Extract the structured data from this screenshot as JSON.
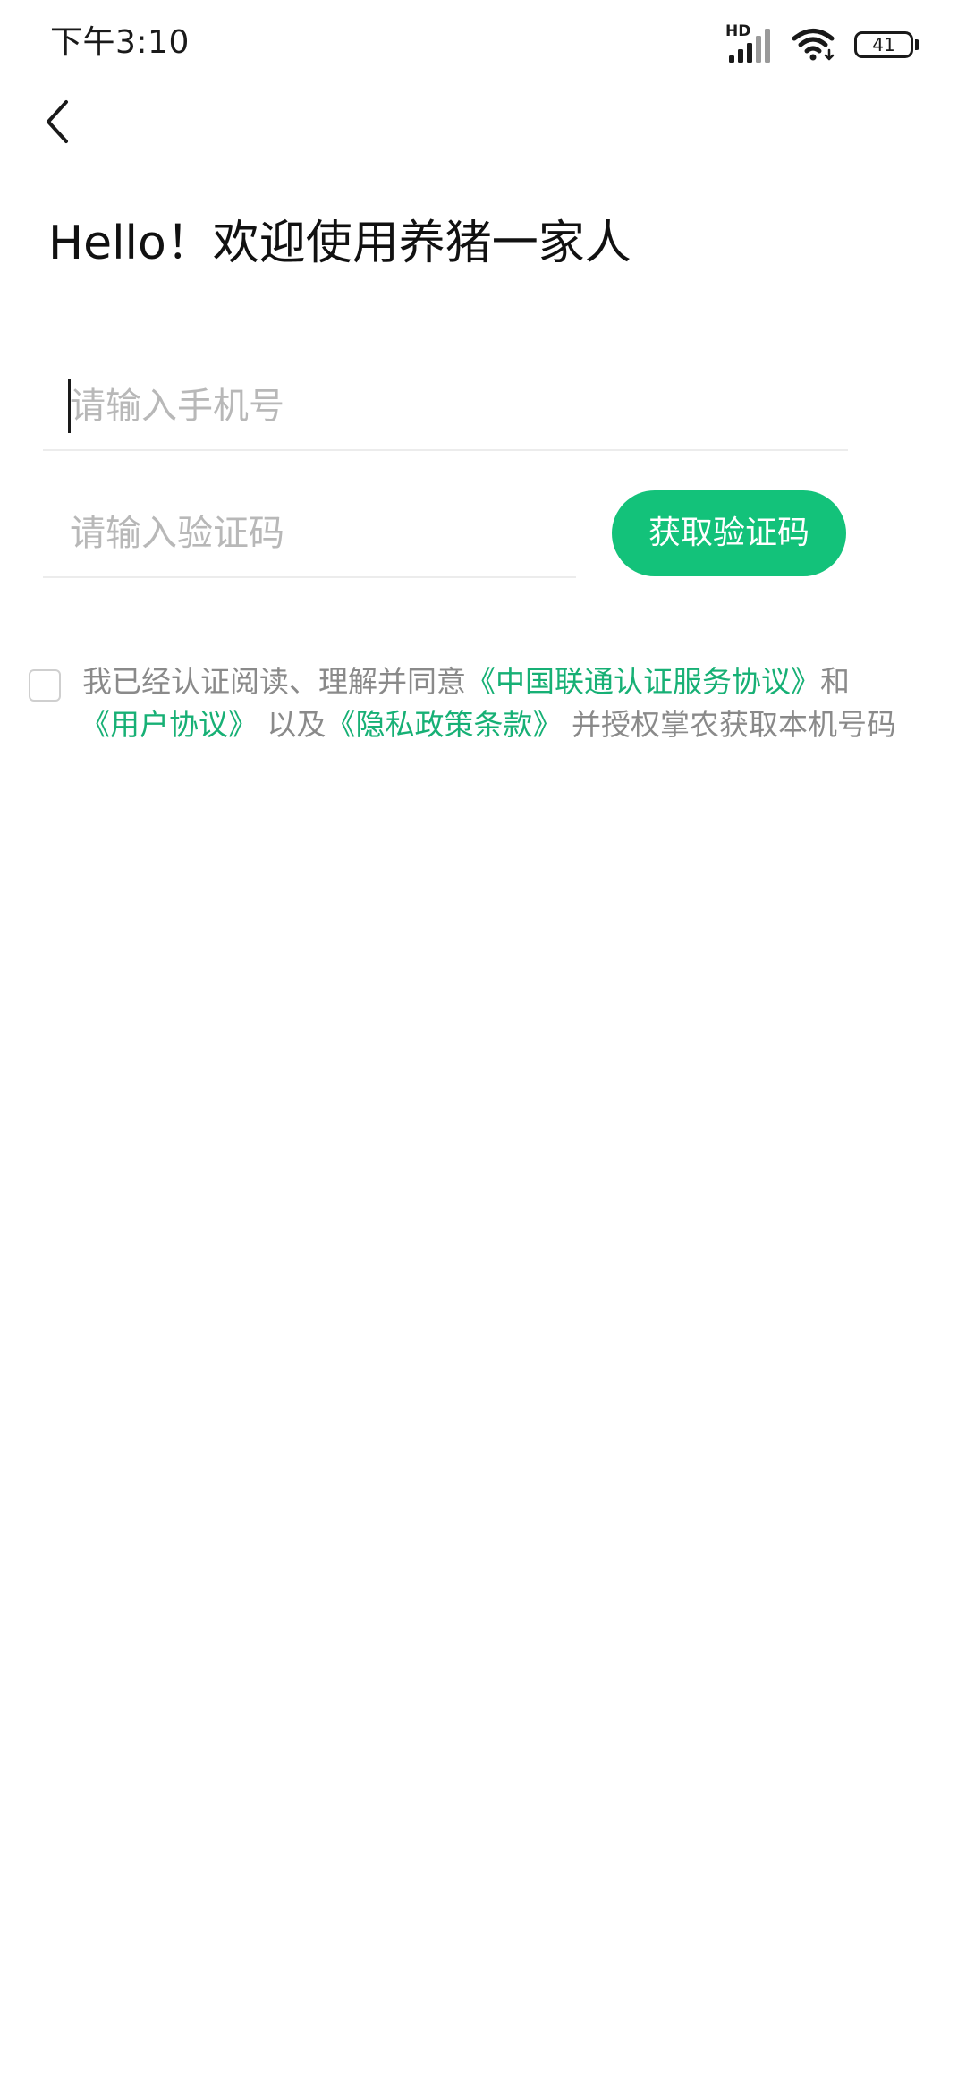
{
  "status_bar": {
    "time": "下午3:10",
    "network_badge": "HD",
    "battery_level": "41",
    "icons": [
      "signal-icon",
      "wifi-icon",
      "battery-icon"
    ]
  },
  "header": {
    "back_icon": "chevron-left-icon",
    "title": "Hello！欢迎使用养猪一家人"
  },
  "form": {
    "phone_placeholder": "请输入手机号",
    "phone_value": "",
    "code_placeholder": "请输入验证码",
    "code_value": "",
    "get_code_label": "获取验证码"
  },
  "agreement": {
    "checked": false,
    "text_before": "我已经认证阅读、理解并同意",
    "link_unicom": "《中国联通认证服务协议》",
    "text_and": "和",
    "link_user": "《用户协议》",
    "text_with": "以及",
    "link_privacy": "《隐私政策条款》",
    "text_after": "并授权掌农获取本机号码"
  },
  "colors": {
    "accent": "#13c27a",
    "link": "#17b075",
    "placeholder": "#b8b8b8",
    "secondary_text": "#8a8a8a",
    "background": "#ffffff"
  }
}
